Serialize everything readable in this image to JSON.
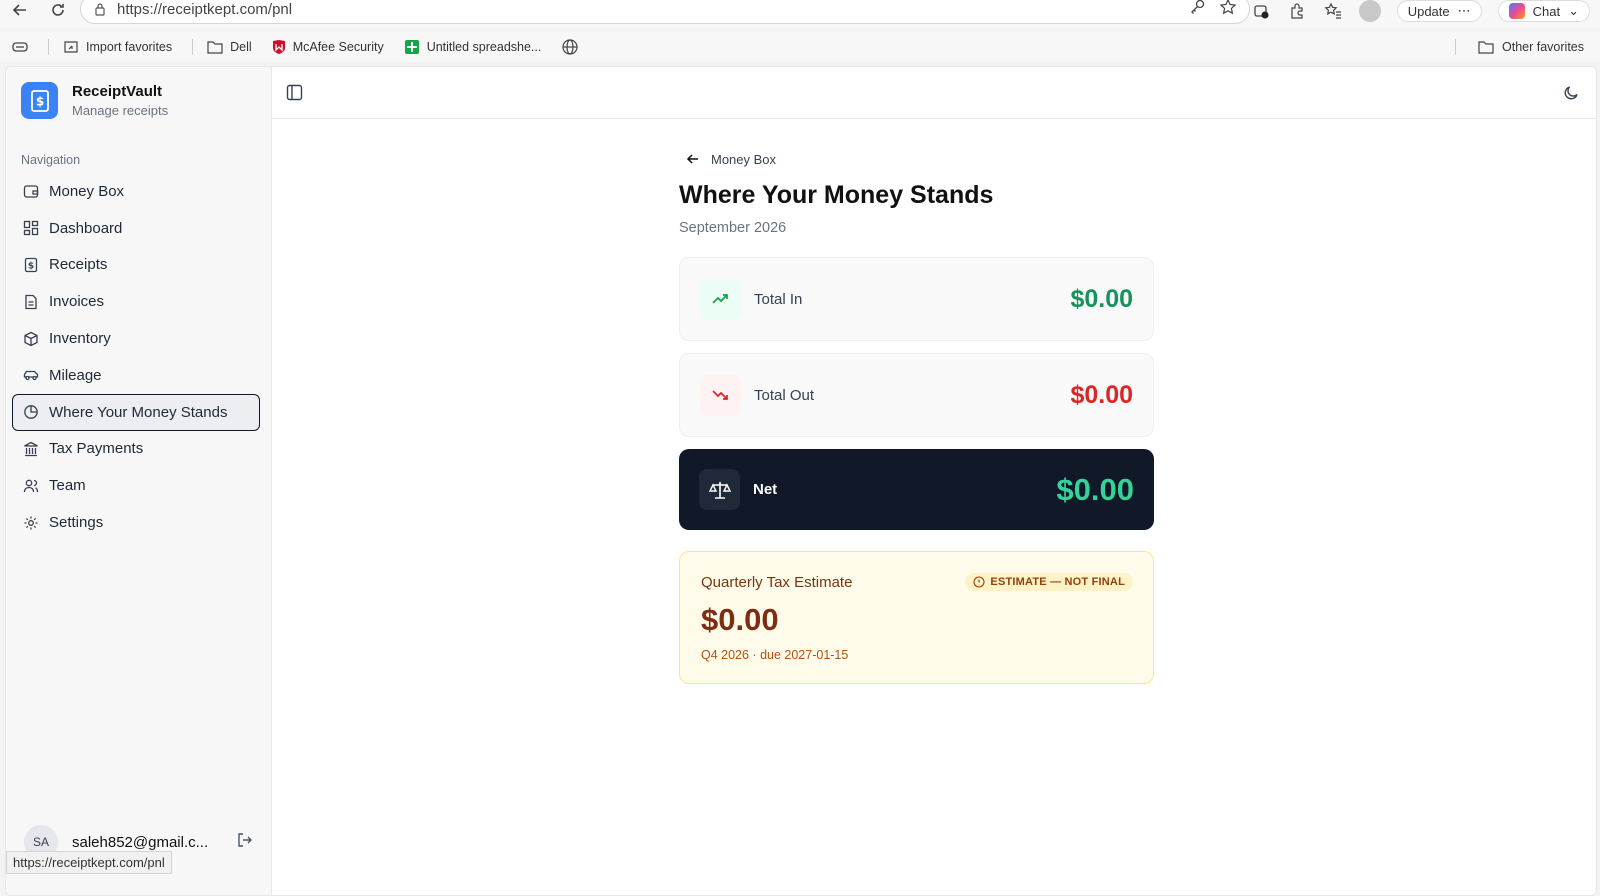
{
  "browser": {
    "url": "https://receiptkept.com/pnl",
    "update_label": "Update",
    "chat_label": "Chat",
    "bookmarks": [
      "Import favorites",
      "Dell",
      "McAfee Security",
      "Untitled spreadshe..."
    ],
    "other_favorites": "Other favorites",
    "status_url": "https://receiptkept.com/pnl"
  },
  "brand": {
    "name": "ReceiptVault",
    "subtitle": "Manage receipts",
    "color": "#3b82f6"
  },
  "sidebar": {
    "section_label": "Navigation",
    "items": [
      {
        "label": "Money Box",
        "icon": "wallet-icon"
      },
      {
        "label": "Dashboard",
        "icon": "grid-icon"
      },
      {
        "label": "Receipts",
        "icon": "receipt-icon"
      },
      {
        "label": "Invoices",
        "icon": "document-icon"
      },
      {
        "label": "Inventory",
        "icon": "box-icon"
      },
      {
        "label": "Mileage",
        "icon": "car-icon"
      },
      {
        "label": "Where Your Money Stands",
        "icon": "pie-chart-icon",
        "active": true
      },
      {
        "label": "Tax Payments",
        "icon": "bank-icon"
      },
      {
        "label": "Team",
        "icon": "users-icon"
      },
      {
        "label": "Settings",
        "icon": "gear-icon"
      }
    ],
    "user": {
      "initials": "SA",
      "email": "saleh852@gmail.c..."
    }
  },
  "main": {
    "back_label": "Money Box",
    "title": "Where Your Money Stands",
    "period": "September 2026",
    "total_in": {
      "label": "Total In",
      "value": "$0.00",
      "color": "#16a34a"
    },
    "total_out": {
      "label": "Total Out",
      "value": "$0.00",
      "color": "#dc2626"
    },
    "net": {
      "label": "Net",
      "value": "$0.00",
      "color": "#34d399"
    },
    "tax": {
      "title": "Quarterly Tax Estimate",
      "badge": "ESTIMATE — NOT FINAL",
      "value": "$0.00",
      "due": "Q4 2026 · due 2027-01-15"
    }
  }
}
